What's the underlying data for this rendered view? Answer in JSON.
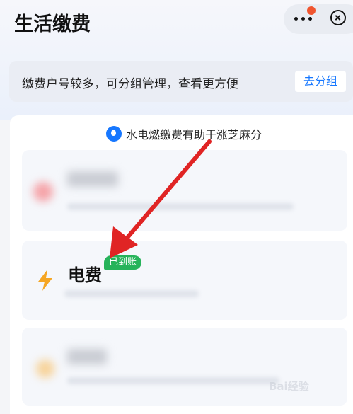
{
  "header": {
    "title": "生活缴费"
  },
  "group_banner": {
    "text": "缴费户号较多，可分组管理，查看更方便",
    "button": "去分组"
  },
  "tip": {
    "text": "水电燃缴费有助于涨芝麻分"
  },
  "bills": [
    {
      "name": "电费",
      "badge": "已到账"
    }
  ],
  "watermark": {
    "text": "Bai经验"
  },
  "colors": {
    "accent": "#1677ff",
    "badge": "#27b35a",
    "arrow": "#e02424",
    "notification_dot": "#f0552f"
  }
}
